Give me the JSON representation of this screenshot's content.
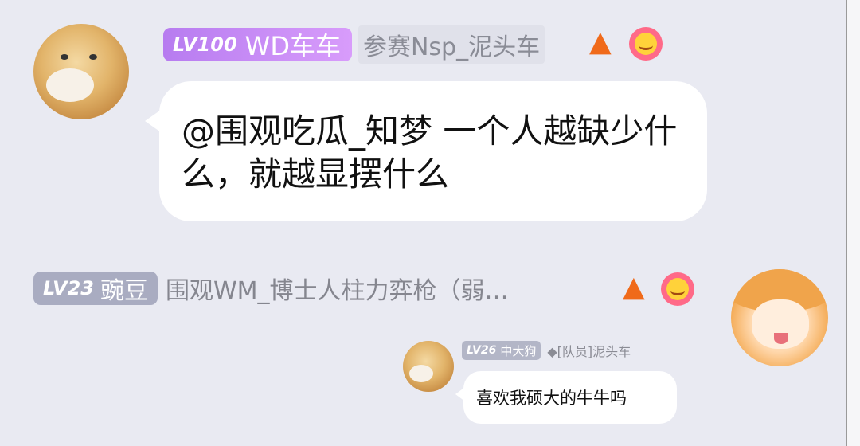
{
  "messages": [
    {
      "level": "LV100",
      "nickname": "WD车车",
      "suffix": "参赛Nsp_泥头车",
      "text": "@围观吃瓜_知梦 一个人越缺少什么，就越显摆什么"
    },
    {
      "level": "LV23",
      "nickname": "豌豆",
      "suffix": "围观WM_博士人柱力弈枪（弱…"
    },
    {
      "level": "LV26",
      "nickname": "中大狗",
      "suffix": "◆[队员]泥头车",
      "text": "喜欢我硕大的牛牛吗"
    }
  ],
  "icons": [
    "fire-icon",
    "flower-smile-icon",
    "shiba-avatar",
    "anime-girl-avatar"
  ],
  "colors": {
    "background": "#e9eaf2",
    "badge_purple": "#c08cf5",
    "badge_gray": "#a9acc1",
    "bubble": "#ffffff"
  }
}
